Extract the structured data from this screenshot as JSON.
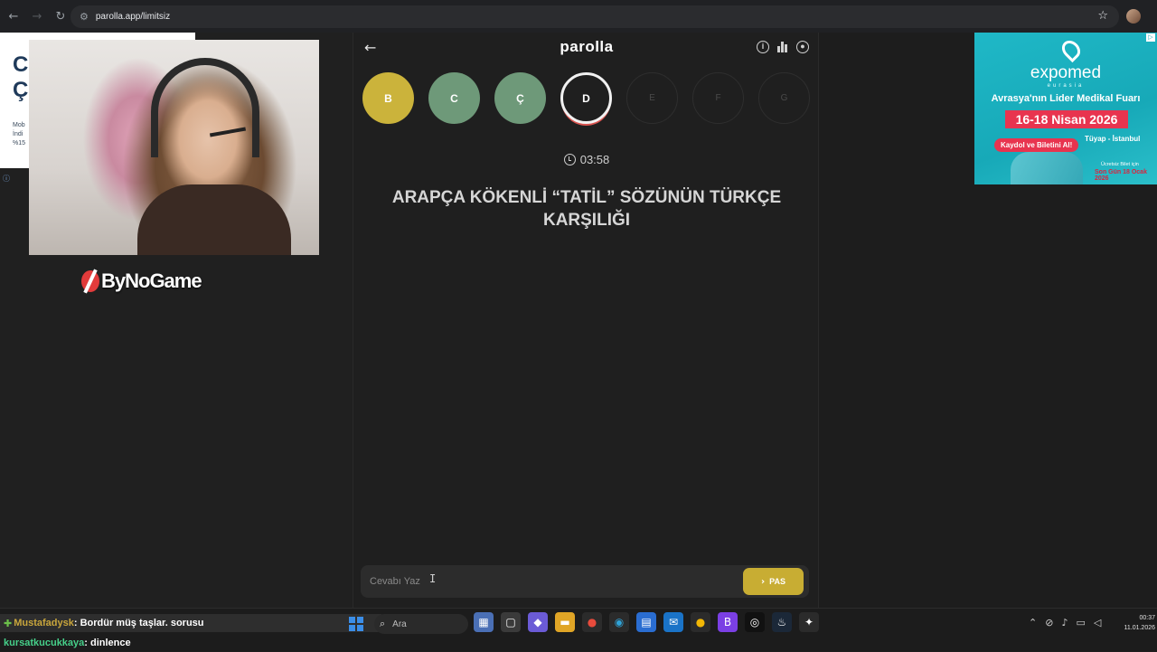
{
  "browser": {
    "url": "parolla.app/limitsiz"
  },
  "left_promo": {
    "line1": "C",
    "line2": "Ç",
    "small1": "Mob",
    "small2": "İndi",
    "small3": "%15"
  },
  "stream": {
    "brand": "ByNoGame"
  },
  "game": {
    "logo": "parolla",
    "letters": [
      {
        "char": "B",
        "state": "yellow"
      },
      {
        "char": "C",
        "state": "green"
      },
      {
        "char": "Ç",
        "state": "green"
      },
      {
        "char": "D",
        "state": "active"
      },
      {
        "char": "E",
        "state": "pending"
      },
      {
        "char": "F",
        "state": "pending"
      },
      {
        "char": "G",
        "state": "pending"
      }
    ],
    "timer": "03:58",
    "question": "ARAPÇA KÖKENLİ “TATİL” SÖZÜNÜN TÜRKÇE KARŞILIĞI",
    "answer": {
      "placeholder": "Cevabı Yaz",
      "value": ""
    },
    "pass_label": "PAS",
    "colors": {
      "yellow": "#cbb33b",
      "green": "#6e9979",
      "active_ring": "#d9534f"
    }
  },
  "ad": {
    "brand": "expomed",
    "sub": "eurasia",
    "headline": "Avrasya'nın Lider Medikal Fuarı",
    "dates": "16-18 Nisan 2026",
    "cta": "Kaydol ve Biletini Al!",
    "location": "Tüyap - İstanbul",
    "note1": "Ücretsiz Bilet için",
    "note2": "Son Gün 18 Ocak 2026"
  },
  "chat": [
    {
      "user": "Mustafadysk",
      "message": ": Bordür müş taşlar. sorusu"
    },
    {
      "user": "kursatkucukkaya",
      "message": ": dinlence"
    }
  ],
  "taskbar": {
    "search_placeholder": "Ara",
    "time": "00:37",
    "date": "11.01.2026"
  }
}
